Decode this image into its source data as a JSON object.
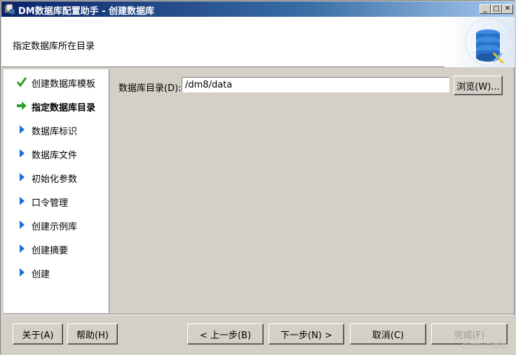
{
  "window": {
    "title": "DM数据库配置助手 - 创建数据库"
  },
  "header": {
    "subtitle": "指定数据库所在目录"
  },
  "steps": [
    {
      "label": "创建数据库模板",
      "state": "done"
    },
    {
      "label": "指定数据库目录",
      "state": "active"
    },
    {
      "label": "数据库标识",
      "state": "pending"
    },
    {
      "label": "数据库文件",
      "state": "pending"
    },
    {
      "label": "初始化参数",
      "state": "pending"
    },
    {
      "label": "口令管理",
      "state": "pending"
    },
    {
      "label": "创建示例库",
      "state": "pending"
    },
    {
      "label": "创建摘要",
      "state": "pending"
    },
    {
      "label": "创建",
      "state": "pending"
    }
  ],
  "form": {
    "dir_label": "数据库目录(D):",
    "dir_value": "/dm8/data",
    "browse": "浏览(W)..."
  },
  "buttons": {
    "about": "关于(A)",
    "help": "帮助(H)",
    "prev": "< 上一步(B)",
    "next": "下一步(N) >",
    "cancel": "取消(C)",
    "finish": "完成(F)"
  },
  "watermark": "@ITPUB博客",
  "colors": {
    "done": "#2e9e2e",
    "active_arrow": "#2e9e2e",
    "pending": "#1e6fd0"
  }
}
